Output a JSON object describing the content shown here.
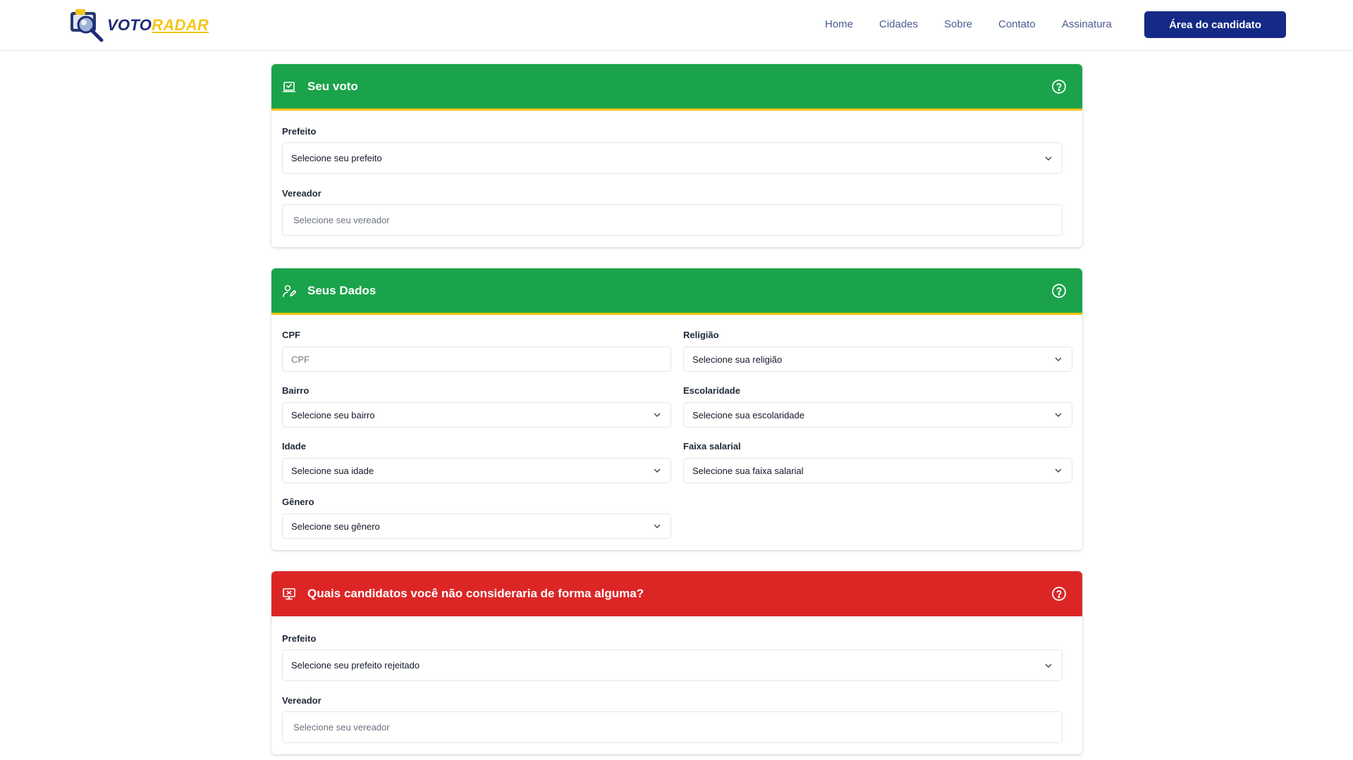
{
  "brand": {
    "part1": "VOTO",
    "part2": "RADAR"
  },
  "nav": {
    "items": [
      "Home",
      "Cidades",
      "Sobre",
      "Contato",
      "Assinatura"
    ],
    "cta": "Área do candidato"
  },
  "colors": {
    "green": "#1aa34a",
    "yellow": "#f2c40f",
    "red": "#dc2626",
    "navy": "#152a86"
  },
  "vote": {
    "title": "Seu voto",
    "mayor_label": "Prefeito",
    "mayor_value": "Selecione seu prefeito",
    "council_label": "Vereador",
    "council_placeholder": "Selecione seu vereador"
  },
  "data_section": {
    "title": "Seus Dados",
    "cpf_label": "CPF",
    "cpf_placeholder": "CPF",
    "religion_label": "Religião",
    "religion_value": "Selecione sua religião",
    "neighborhood_label": "Bairro",
    "neighborhood_value": "Selecione seu bairro",
    "education_label": "Escolaridade",
    "education_value": "Selecione sua escolaridade",
    "age_label": "Idade",
    "age_value": "Selecione sua idade",
    "income_label": "Faixa salarial",
    "income_value": "Selecione sua faixa salarial",
    "gender_label": "Gênero",
    "gender_value": "Selecione seu gênero"
  },
  "reject": {
    "title": "Quais candidatos você não consideraria de forma alguma?",
    "mayor_label": "Prefeito",
    "mayor_value": "Selecione seu prefeito rejeitado",
    "council_label": "Vereador",
    "council_placeholder": "Selecione seu vereador"
  }
}
